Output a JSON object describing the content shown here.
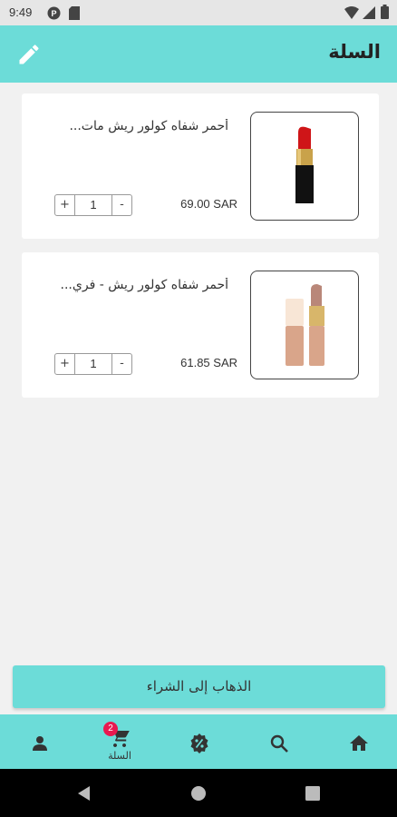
{
  "status_bar": {
    "time": "9:49"
  },
  "header": {
    "title": "السلة"
  },
  "cart": {
    "items": [
      {
        "name": "أحمر شفاه  كولور ريش مات...",
        "price": "69.00 SAR",
        "quantity": "1",
        "plus": "+",
        "minus": "-"
      },
      {
        "name": "أحمر شفاه كولور ريش - فري...",
        "price": "61.85 SAR",
        "quantity": "1",
        "plus": "+",
        "minus": "-"
      }
    ]
  },
  "checkout": {
    "label": "الذهاب إلى الشراء"
  },
  "bottom_nav": {
    "cart_label": "السلة",
    "cart_badge": "2",
    "icons": [
      "home-icon",
      "search-icon",
      "offers-icon",
      "cart-icon",
      "profile-icon"
    ]
  },
  "colors": {
    "accent": "#6cdcd8",
    "badge": "#e8194f",
    "background": "#f1f1f1"
  }
}
